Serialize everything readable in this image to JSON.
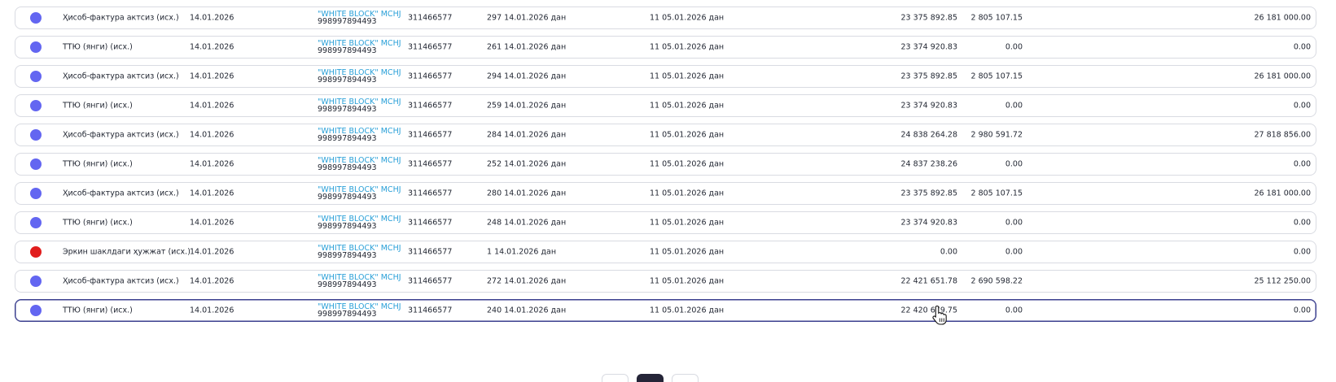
{
  "colors": {
    "status_blue": "#6366f1",
    "status_red": "#e11d1d",
    "partner_link": "#2aa0d8",
    "active_border": "#3b3f8f"
  },
  "documents": [
    {
      "status": "blue",
      "type": "Ҳисоб-фактура актсиз (исх.)",
      "date": "14.01.2026",
      "partner_name": "\"WHITE BLOCK\" MCHJ",
      "partner_phone": "998997894493",
      "inn": "311466577",
      "doc": "297 14.01.2026 дан",
      "contract": "11 05.01.2026 дан",
      "sum": "23 375 892.85",
      "vat": "2 805 107.15",
      "total": "26 181 000.00"
    },
    {
      "status": "blue",
      "type": "ТТЮ (янги) (исх.)",
      "date": "14.01.2026",
      "partner_name": "\"WHITE BLOCK\" MCHJ",
      "partner_phone": "998997894493",
      "inn": "311466577",
      "doc": "261 14.01.2026 дан",
      "contract": "11 05.01.2026 дан",
      "sum": "23 374 920.83",
      "vat": "0.00",
      "total": "0.00"
    },
    {
      "status": "blue",
      "type": "Ҳисоб-фактура актсиз (исх.)",
      "date": "14.01.2026",
      "partner_name": "\"WHITE BLOCK\" MCHJ",
      "partner_phone": "998997894493",
      "inn": "311466577",
      "doc": "294 14.01.2026 дан",
      "contract": "11 05.01.2026 дан",
      "sum": "23 375 892.85",
      "vat": "2 805 107.15",
      "total": "26 181 000.00"
    },
    {
      "status": "blue",
      "type": "ТТЮ (янги) (исх.)",
      "date": "14.01.2026",
      "partner_name": "\"WHITE BLOCK\" MCHJ",
      "partner_phone": "998997894493",
      "inn": "311466577",
      "doc": "259 14.01.2026 дан",
      "contract": "11 05.01.2026 дан",
      "sum": "23 374 920.83",
      "vat": "0.00",
      "total": "0.00"
    },
    {
      "status": "blue",
      "type": "Ҳисоб-фактура актсиз (исх.)",
      "date": "14.01.2026",
      "partner_name": "\"WHITE BLOCK\" MCHJ",
      "partner_phone": "998997894493",
      "inn": "311466577",
      "doc": "284 14.01.2026 дан",
      "contract": "11 05.01.2026 дан",
      "sum": "24 838 264.28",
      "vat": "2 980 591.72",
      "total": "27 818 856.00"
    },
    {
      "status": "blue",
      "type": "ТТЮ (янги) (исх.)",
      "date": "14.01.2026",
      "partner_name": "\"WHITE BLOCK\" MCHJ",
      "partner_phone": "998997894493",
      "inn": "311466577",
      "doc": "252 14.01.2026 дан",
      "contract": "11 05.01.2026 дан",
      "sum": "24 837 238.26",
      "vat": "0.00",
      "total": "0.00"
    },
    {
      "status": "blue",
      "type": "Ҳисоб-фактура актсиз (исх.)",
      "date": "14.01.2026",
      "partner_name": "\"WHITE BLOCK\" MCHJ",
      "partner_phone": "998997894493",
      "inn": "311466577",
      "doc": "280 14.01.2026 дан",
      "contract": "11 05.01.2026 дан",
      "sum": "23 375 892.85",
      "vat": "2 805 107.15",
      "total": "26 181 000.00"
    },
    {
      "status": "blue",
      "type": "ТТЮ (янги) (исх.)",
      "date": "14.01.2026",
      "partner_name": "\"WHITE BLOCK\" MCHJ",
      "partner_phone": "998997894493",
      "inn": "311466577",
      "doc": "248 14.01.2026 дан",
      "contract": "11 05.01.2026 дан",
      "sum": "23 374 920.83",
      "vat": "0.00",
      "total": "0.00"
    },
    {
      "status": "red",
      "type": "Эркин шаклдаги ҳужжат (исх.)",
      "date": "14.01.2026",
      "partner_name": "\"WHITE BLOCK\" MCHJ",
      "partner_phone": "998997894493",
      "inn": "311466577",
      "doc": "1 14.01.2026 дан",
      "contract": "11 05.01.2026 дан",
      "sum": "0.00",
      "vat": "0.00",
      "total": "0.00"
    },
    {
      "status": "blue",
      "type": "Ҳисоб-фактура актсиз (исх.)",
      "date": "14.01.2026",
      "partner_name": "\"WHITE BLOCK\" MCHJ",
      "partner_phone": "998997894493",
      "inn": "311466577",
      "doc": "272 14.01.2026 дан",
      "contract": "11 05.01.2026 дан",
      "sum": "22 421 651.78",
      "vat": "2 690 598.22",
      "total": "25 112 250.00"
    },
    {
      "status": "blue",
      "type": "ТТЮ (янги) (исх.)",
      "date": "14.01.2026",
      "partner_name": "\"WHITE BLOCK\" MCHJ",
      "partner_phone": "998997894493",
      "inn": "311466577",
      "doc": "240 14.01.2026 дан",
      "contract": "11 05.01.2026 дан",
      "sum": "22 420 679.75",
      "vat": "0.00",
      "total": "0.00",
      "active": true
    }
  ],
  "pagination": {
    "buttons": [
      {
        "id": "prev",
        "current": false
      },
      {
        "id": "current",
        "current": true
      },
      {
        "id": "next",
        "current": false
      }
    ]
  },
  "cursor_icon": "hand-pointer-icon"
}
